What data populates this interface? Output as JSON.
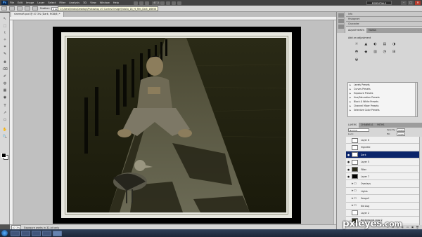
{
  "app": {
    "logo_text": "Ps",
    "menu": [
      "File",
      "Edit",
      "Image",
      "Layer",
      "Select",
      "Filter",
      "Analysis",
      "3D",
      "View",
      "Window",
      "Help"
    ],
    "zoom": "47.3",
    "workspace": "ESSENTIALS",
    "window_controls": [
      "–",
      "□",
      "✕"
    ]
  },
  "options_bar": {
    "feather_label": "Feather:",
    "feather_value": "0 px",
    "tooltip": "C:\\Users\\Ikkatu\\Desktop\\Photoshop #3 Contest Image\\Fotolia_18_Hi_Res_Dark_#8658"
  },
  "document": {
    "tab_title": "sinemoft.psd @ 47.3% (Dark, RGB/8) *"
  },
  "status_bar": {
    "zoom": "47.3%",
    "info": "Exposure works in 32-bit only"
  },
  "watermark": {
    "name": "pxleyes",
    "domain": ".com"
  },
  "panels": {
    "collapsed": [
      "Info",
      "Histogram",
      "Character"
    ],
    "adjustments_tabs": [
      "ADJUSTMENTS",
      "MASKS"
    ],
    "adjustments_title": "Add an adjustment",
    "adjustment_icons": [
      "☼",
      "▲",
      "◐",
      "▤",
      "◑",
      "◓",
      "◆",
      "▥",
      "◔",
      "⊞",
      "◒"
    ],
    "presets": [
      "Levels Presets",
      "Curves Presets",
      "Exposure Presets",
      "Hue/Saturation Presets",
      "Black & White Presets",
      "Channel Mixer Presets",
      "Selective Color Presets"
    ]
  },
  "layers": {
    "tabs": [
      "LAYERS",
      "CHANNELS",
      "PATHS"
    ],
    "blend_mode": "Normal",
    "opacity_label": "Opacity:",
    "opacity": "100%",
    "lock_label": "Lock:",
    "fill_label": "Fill:",
    "fill": "100%",
    "items": [
      {
        "name": "Layer 6",
        "visible": false,
        "thumb": "white"
      },
      {
        "name": "Vignette",
        "visible": false,
        "thumb": "white"
      },
      {
        "name": "Dark",
        "visible": true,
        "thumb": "white",
        "selected": true
      },
      {
        "name": "Layer 5",
        "visible": true,
        "thumb": "white"
      },
      {
        "name": "Filter",
        "visible": true,
        "thumb": "dark"
      },
      {
        "name": "Layer 7",
        "visible": true,
        "thumb": "black"
      },
      {
        "name": "Overlays",
        "visible": false,
        "thumb": "folder"
      },
      {
        "name": "Lights",
        "visible": false,
        "thumb": "folder"
      },
      {
        "name": "Seagull",
        "visible": false,
        "thumb": "folder"
      },
      {
        "name": "Kid Aug",
        "visible": false,
        "thumb": "folder"
      },
      {
        "name": "Layer 2",
        "visible": false,
        "thumb": "white"
      },
      {
        "name": "Background copy 2",
        "visible": false,
        "thumb": "dark"
      },
      {
        "name": "Background copy",
        "visible": false,
        "thumb": "dark"
      }
    ],
    "footer_icons": [
      "∞",
      "fx",
      "◎",
      "◐",
      "▭",
      "▣",
      "🗑"
    ]
  },
  "toolbox": {
    "tools": [
      "↖",
      "⬚",
      "⌇",
      "✧",
      "⌗",
      "✎",
      "✚",
      "⌫",
      "✐",
      "◍",
      "▦",
      "◉",
      "T",
      "↗",
      "▭",
      "✋",
      "🔍"
    ]
  }
}
